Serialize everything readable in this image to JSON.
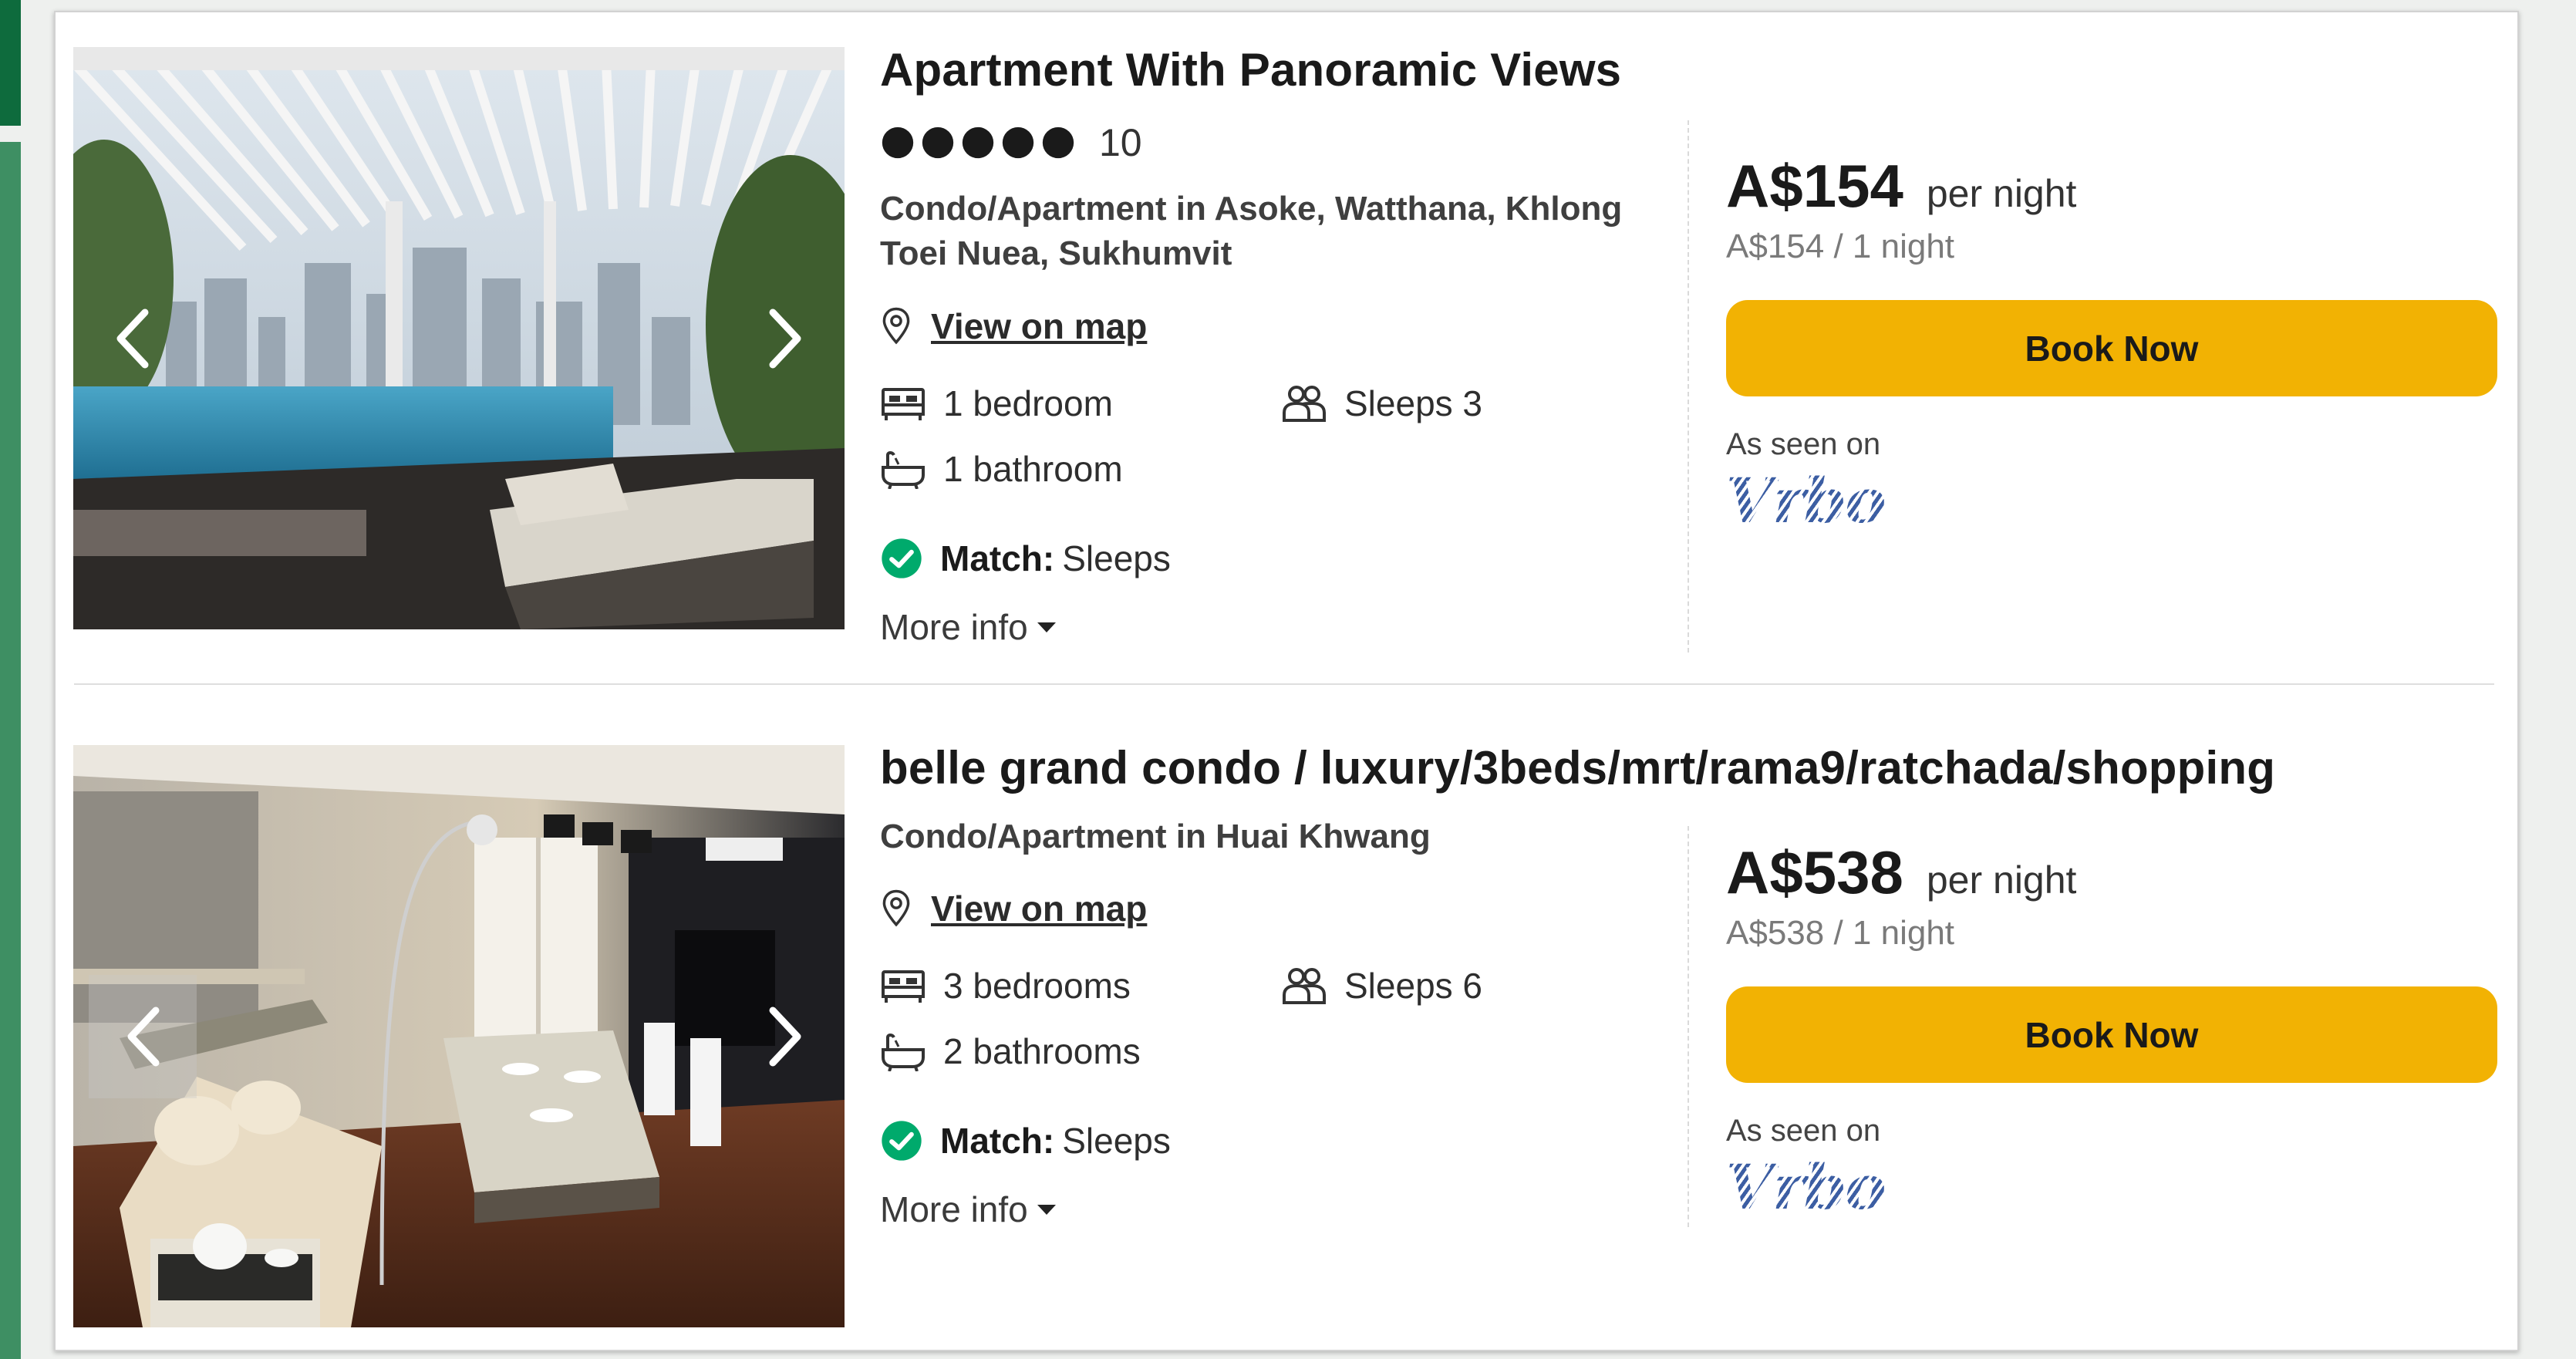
{
  "brand": {
    "accent": "#f2b203",
    "vrbo": "#2b4a88",
    "match_green": "#00aa6c",
    "side_green": "#0e6b3d"
  },
  "listings": [
    {
      "title": "Apartment With Panoramic Views",
      "rating": {
        "stars": 5,
        "max_stars": 5,
        "review_count": "10"
      },
      "location": "Condo/Apartment in Asoke, Watthana, Khlong Toei Nuea, Sukhumvit",
      "map_link": "View on map",
      "bedrooms": "1 bedroom",
      "bathrooms": "1 bathroom",
      "sleeps": "Sleeps 3",
      "match_key": "Match:",
      "match_value": "Sleeps",
      "more_info": "More info",
      "price": "A$154",
      "per_night": "per night",
      "total": "A$154 / 1 night",
      "book_label": "Book Now",
      "seen_on": "As seen on",
      "provider": "Vrbo",
      "icons": [
        "chevron-left-icon",
        "chevron-right-icon",
        "location-pin-icon",
        "bed-icon",
        "bathtub-icon",
        "people-icon",
        "check-circle-icon",
        "caret-down-icon"
      ]
    },
    {
      "title": "belle grand condo / luxury/3beds/mrt/rama9/ratchada/shopping",
      "location": "Condo/Apartment in Huai Khwang",
      "map_link": "View on map",
      "bedrooms": "3 bedrooms",
      "bathrooms": "2 bathrooms",
      "sleeps": "Sleeps 6",
      "match_key": "Match:",
      "match_value": "Sleeps",
      "more_info": "More info",
      "price": "A$538",
      "per_night": "per night",
      "total": "A$538 / 1 night",
      "book_label": "Book Now",
      "seen_on": "As seen on",
      "provider": "Vrbo"
    }
  ]
}
